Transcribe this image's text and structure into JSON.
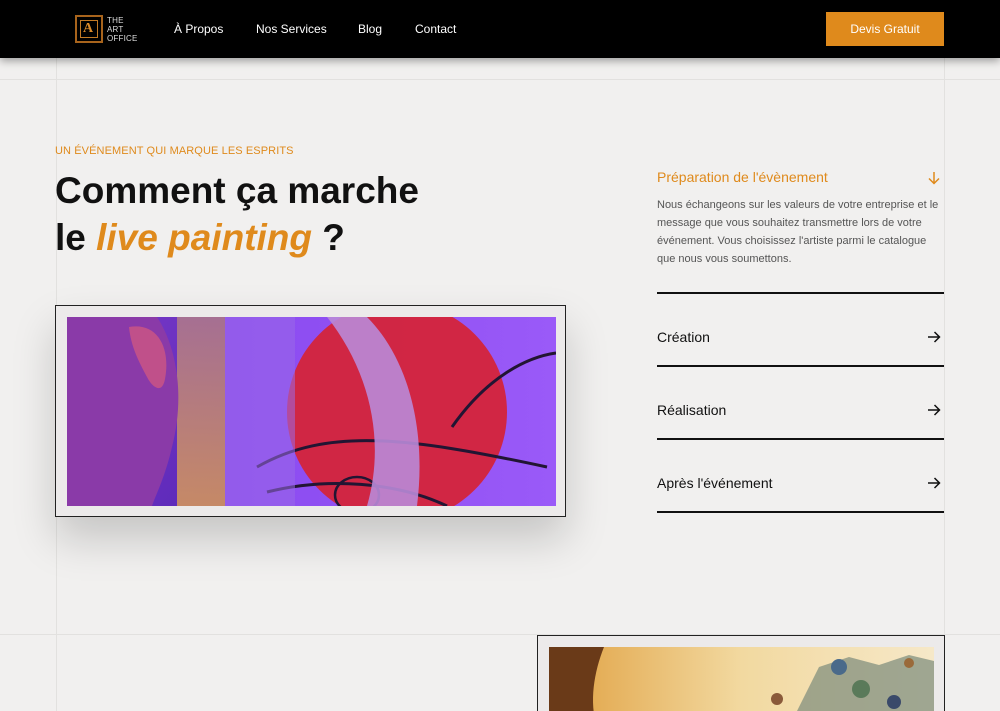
{
  "brand": {
    "logo_letter": "A",
    "logo_text": [
      "THE",
      "ART",
      "OFFICE"
    ]
  },
  "nav": {
    "items": [
      "À Propos",
      "Nos Services",
      "Blog",
      "Contact"
    ],
    "cta_label": "Devis Gratuit"
  },
  "hero": {
    "eyebrow": "UN ÉVÉNEMENT QUI MARQUE LES ESPRITS",
    "title_line1": "Comment ça marche",
    "title_line2_prefix": "le ",
    "title_line2_highlight": "live painting",
    "title_line2_suffix": " ?"
  },
  "accordion": {
    "open_item": {
      "title": "Préparation de l'évènement",
      "icon": "arrow-down-icon",
      "body": "Nous échangeons sur les valeurs de votre entreprise et le message que vous souhaitez transmettre lors de votre événement. Vous choisissez l'artiste parmi le catalogue que nous vous soumettons."
    },
    "items": [
      {
        "title": "Création",
        "icon": "arrow-right-icon"
      },
      {
        "title": "Réalisation",
        "icon": "arrow-right-icon"
      },
      {
        "title": "Après l'événement",
        "icon": "arrow-right-icon"
      }
    ]
  },
  "colors": {
    "accent": "#df8a1c",
    "header_bg": "#000000",
    "page_bg": "#f1f0ef",
    "text": "#111111"
  }
}
